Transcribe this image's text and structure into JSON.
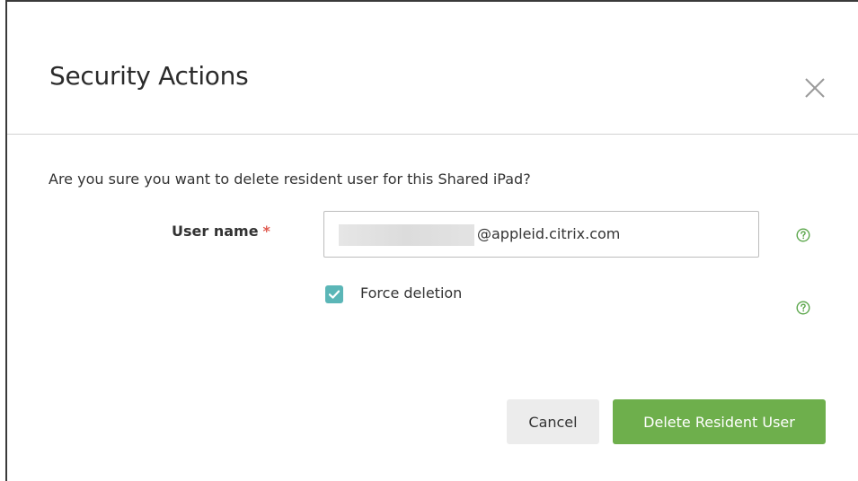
{
  "dialog": {
    "title": "Security Actions",
    "close_icon": "close-icon",
    "question": "Are you sure you want to delete resident user for this Shared iPad?"
  },
  "form": {
    "username_label": "User name",
    "required_marker": "*",
    "username_value_visible": "@appleid.citrix.com",
    "username_help_icon": "help-icon",
    "force_deletion_label": "Force deletion",
    "force_deletion_checked": true,
    "force_deletion_help_icon": "help-icon"
  },
  "actions": {
    "cancel_label": "Cancel",
    "delete_label": "Delete Resident User"
  },
  "colors": {
    "primary_button": "#6eaf4c",
    "secondary_button": "#ececec",
    "checkbox": "#5bb6b7",
    "help_icon": "#5aa64a",
    "required": "#e05a4f"
  }
}
